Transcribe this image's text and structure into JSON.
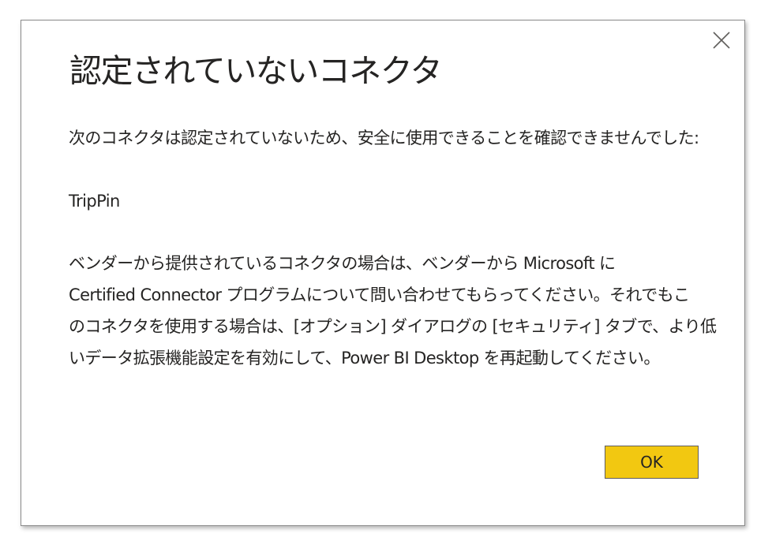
{
  "dialog": {
    "title": "認定されていないコネクタ",
    "intro": "次のコネクタは認定されていないため、安全に使用できることを確認できませんでした:",
    "connector_name": "TripPin",
    "message_lines": [
      "ベンダーから提供されているコネクタの場合は、ベンダーから Microsoft に",
      "Certified Connector プログラムについて問い合わせてもらってください。それでもこ",
      "のコネクタを使用する場合は、[オプション] ダイアログの [セキュリティ] タブで、より低",
      "いデータ拡張機能設定を有効にして、Power BI Desktop を再起動してください。"
    ],
    "ok_label": "OK",
    "close_icon": "close-icon"
  },
  "colors": {
    "accent_button": "#F2C811",
    "text": "#252423",
    "border": "#8A8A8A"
  }
}
